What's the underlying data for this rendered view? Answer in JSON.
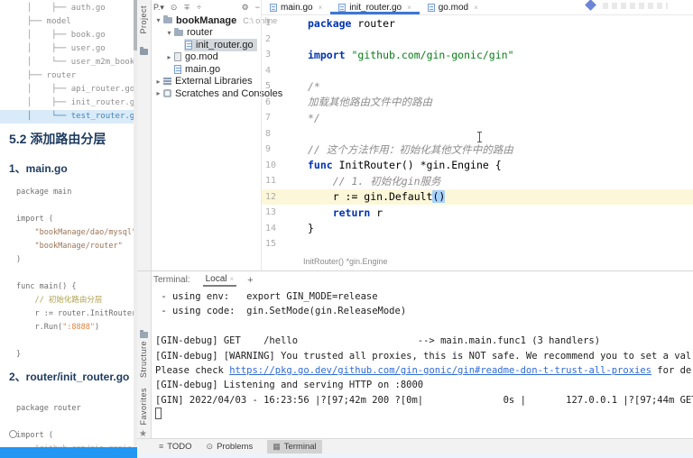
{
  "doc": {
    "tree": [
      {
        "text": "│    ├── auth.go"
      },
      {
        "text": "├── model"
      },
      {
        "text": "│    ├── book.go"
      },
      {
        "text": "│    ├── user.go"
      },
      {
        "text": "│    └── user_m2m_book.go"
      },
      {
        "text": "├── router"
      },
      {
        "text": "│    ├── api_router.go"
      },
      {
        "text": "│    ├── init_router.go"
      },
      {
        "text": "│    └── test_router.go",
        "highlight": true
      }
    ],
    "section_title": "5.2 添加路由分层",
    "subsection1": "1、main.go",
    "code_main_go": [
      [
        [
          "p",
          "package main"
        ]
      ],
      [],
      [
        [
          "p",
          "import ("
        ]
      ],
      [
        [
          "p",
          "    "
        ],
        [
          "b",
          "\"bookManage/dao/mysql\""
        ]
      ],
      [
        [
          "p",
          "    "
        ],
        [
          "b",
          "\"bookManage/router\""
        ]
      ],
      [
        [
          "p",
          ")"
        ]
      ],
      [],
      [
        [
          "p",
          "func main() {"
        ]
      ],
      [
        [
          "p",
          "    "
        ],
        [
          "c2",
          "// 初始化路由分层"
        ]
      ],
      [
        [
          "p",
          "    r := router.InitRouter()"
        ]
      ],
      [
        [
          "p",
          "    r.Run("
        ],
        [
          "o",
          "\":8888\""
        ],
        [
          "p",
          ")"
        ]
      ],
      [],
      [
        [
          "p",
          "}"
        ]
      ]
    ],
    "subsection2": "2、router/init_router.go",
    "code_init_router": [
      [
        [
          "p",
          "package router"
        ]
      ],
      [],
      [
        [
          "p",
          "import ("
        ]
      ],
      [
        [
          "p",
          "    "
        ],
        [
          "faint",
          "\"github.com/gin-gonic/gin\""
        ]
      ]
    ]
  },
  "stripe": {
    "project_label": "Project",
    "structure_label": "Structure",
    "favorites_label": "Favorites",
    "star_glyph": "★"
  },
  "project_panel": {
    "selector_label": "P.▾",
    "left_icons": [
      {
        "name": "locate-icon",
        "glyph": "⊙"
      },
      {
        "name": "collapse-all-icon",
        "glyph": "∓"
      },
      {
        "name": "expand-icon",
        "glyph": "÷"
      }
    ],
    "right_icons": [
      {
        "name": "gear-icon",
        "glyph": "⚙"
      },
      {
        "name": "hide-panel-icon",
        "glyph": "−"
      }
    ],
    "tree": [
      {
        "chevron": "▾",
        "icon": "folder",
        "label": "bookManage",
        "suffix": "C:\\ online",
        "level": 0,
        "bold": true
      },
      {
        "chevron": "▾",
        "icon": "folder",
        "label": "router",
        "level": 1
      },
      {
        "chevron": "",
        "icon": "gofile",
        "label": "init_router.go",
        "level": 2,
        "selected": true
      },
      {
        "chevron": "▸",
        "icon": "gomod",
        "label": "go.mod",
        "level": 1
      },
      {
        "chevron": "",
        "icon": "gofile",
        "label": "main.go",
        "level": 1
      },
      {
        "chevron": "▸",
        "icon": "lib",
        "label": "External Libraries",
        "level": 0
      },
      {
        "chevron": "▸",
        "icon": "scratch",
        "label": "Scratches and Consoles",
        "level": 0
      }
    ]
  },
  "editor": {
    "tabs": [
      {
        "label": "main.go",
        "active": false
      },
      {
        "label": "init_router.go",
        "active": true
      },
      {
        "label": "go.mod",
        "active": false
      }
    ],
    "close_glyph": "×",
    "current_line": 12,
    "lines": [
      {
        "n": "1",
        "segs": [
          [
            "k",
            "package"
          ],
          [
            "p",
            " router"
          ]
        ]
      },
      {
        "n": "2",
        "segs": []
      },
      {
        "n": "3",
        "segs": [
          [
            "k",
            "import"
          ],
          [
            "p",
            " "
          ],
          [
            "s",
            "\"github.com/gin-gonic/gin\""
          ]
        ]
      },
      {
        "n": "4",
        "segs": []
      },
      {
        "n": "5",
        "segs": [
          [
            "c",
            "/*"
          ]
        ]
      },
      {
        "n": "6",
        "segs": [
          [
            "c",
            "加载其他路由文件中的路由"
          ]
        ]
      },
      {
        "n": "7",
        "segs": [
          [
            "c",
            "*/"
          ]
        ]
      },
      {
        "n": "8",
        "segs": []
      },
      {
        "n": "9",
        "segs": [
          [
            "c",
            "// 这个方法作用：初始化其他文件中的路由"
          ]
        ]
      },
      {
        "n": "10",
        "segs": [
          [
            "k",
            "func"
          ],
          [
            "p",
            " InitRouter() *gin.Engine {"
          ]
        ]
      },
      {
        "n": "11",
        "segs": [
          [
            "p",
            "    "
          ],
          [
            "c",
            "// 1. 初始化gin服务"
          ]
        ]
      },
      {
        "n": "12",
        "segs": [
          [
            "p",
            "    r := gin.Default"
          ],
          [
            "sel",
            "()"
          ]
        ]
      },
      {
        "n": "13",
        "segs": [
          [
            "p",
            "    "
          ],
          [
            "k",
            "return"
          ],
          [
            "p",
            " r"
          ]
        ]
      },
      {
        "n": "14",
        "segs": [
          [
            "p",
            "}"
          ]
        ]
      },
      {
        "n": "15",
        "segs": []
      }
    ],
    "hint": "InitRouter() *gin.Engine"
  },
  "terminal": {
    "label": "Terminal:",
    "tab": "Local",
    "close_glyph": "×",
    "add_glyph": "+",
    "lines": [
      [
        [
          "t",
          " - using env:   export GIN_MODE=release"
        ]
      ],
      [
        [
          "t",
          " - using code:  gin.SetMode(gin.ReleaseMode)"
        ]
      ],
      [],
      [
        [
          "t",
          "[GIN-debug] GET    /hello                     --> main.main.func1 (3 handlers)"
        ]
      ],
      [
        [
          "t",
          "[GIN-debug] [WARNING] You trusted all proxies, this is NOT safe. We recommend you to set a val"
        ]
      ],
      [
        [
          "t",
          "Please check "
        ],
        [
          "url",
          "https://pkg.go.dev/github.com/gin-gonic/gin#readme-don-t-trust-all-proxies"
        ],
        [
          "t",
          " for de"
        ]
      ],
      [
        [
          "t",
          "[GIN-debug] Listening and serving HTTP on :8000"
        ]
      ],
      [
        [
          "t",
          "[GIN] 2022/04/03 - 16:23:56 |?[97;42m 200 ?[0m|              0s |       127.0.0.1 |?[97;44m GET"
        ]
      ]
    ]
  },
  "bottom_bar": {
    "items": [
      {
        "icon_name": "todo-list-icon",
        "glyph": "≡",
        "label": "TODO",
        "active": false
      },
      {
        "icon_name": "problems-icon",
        "glyph": "⊙",
        "label": "Problems",
        "active": false
      },
      {
        "icon_name": "terminal-icon",
        "glyph": "▦",
        "label": "Terminal",
        "active": true
      }
    ]
  },
  "colors": {
    "accent_blue": "#3b77d8",
    "selection_blue": "#a6d2ff",
    "keyword": "#0033b3",
    "string_green": "#067d17",
    "comment_gray": "#8c8c8c",
    "progress_blue": "#2196f3",
    "doc_heading": "#1d3a5f",
    "doc_highlight_bg": "#d9eaf8"
  }
}
